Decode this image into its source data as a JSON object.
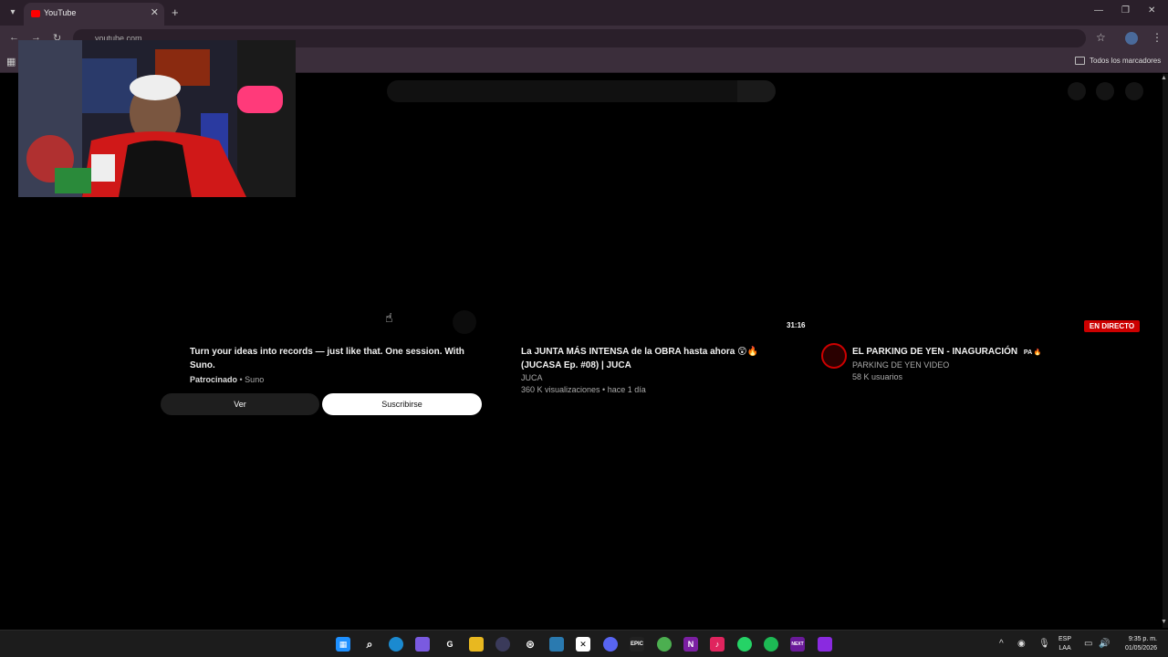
{
  "browser": {
    "tab_title": "YouTube",
    "url": "youtube.com",
    "bookmarks_label": "Todos los marcadores",
    "colors": {
      "chrome": "#3b2e3b",
      "tabbar": "#2a1f2a"
    }
  },
  "cards": {
    "ad": {
      "title": "Turn your ideas into records — just like that. One session. With Suno.",
      "sponsored": "Patrocinado",
      "advertiser": "• Suno",
      "view_button": "Ver",
      "subscribe_button": "Suscribirse"
    },
    "video": {
      "duration": "31:16",
      "title": "La JUNTA MÁS INTENSA de la OBRA hasta ahora 😲🔥 (JUCASA Ep. #08) | JUCA",
      "channel": "JUCA",
      "stats": "360 K visualizaciones • hace 1 día"
    },
    "live": {
      "badge": "EN DIRECTO",
      "title": "EL PARKING DE YEN - INAGURACIÓN",
      "title_suffix": "PA 🔥",
      "channel": "PARKING DE YEN VIDEO",
      "viewers": "58 K usuarios",
      "badge_color": "#cc0000"
    }
  },
  "taskbar": {
    "lang_top": "ESP",
    "lang_bottom": "LAA",
    "time": "9:35 p. m.",
    "date": "01/05/2026",
    "icons": [
      "windows-start-icon",
      "search-icon",
      "edge-icon",
      "copilot-icon",
      "chatgpt-icon",
      "file-explorer-icon",
      "app-icon",
      "chatgpt-alt-icon",
      "calculator-icon",
      "capcut-icon",
      "discord-icon",
      "epic-games-icon",
      "chrome-icon",
      "onenote-icon",
      "tiktok-icon",
      "whatsapp-icon",
      "spotify-icon",
      "next-icon",
      "app-purple-icon"
    ]
  }
}
